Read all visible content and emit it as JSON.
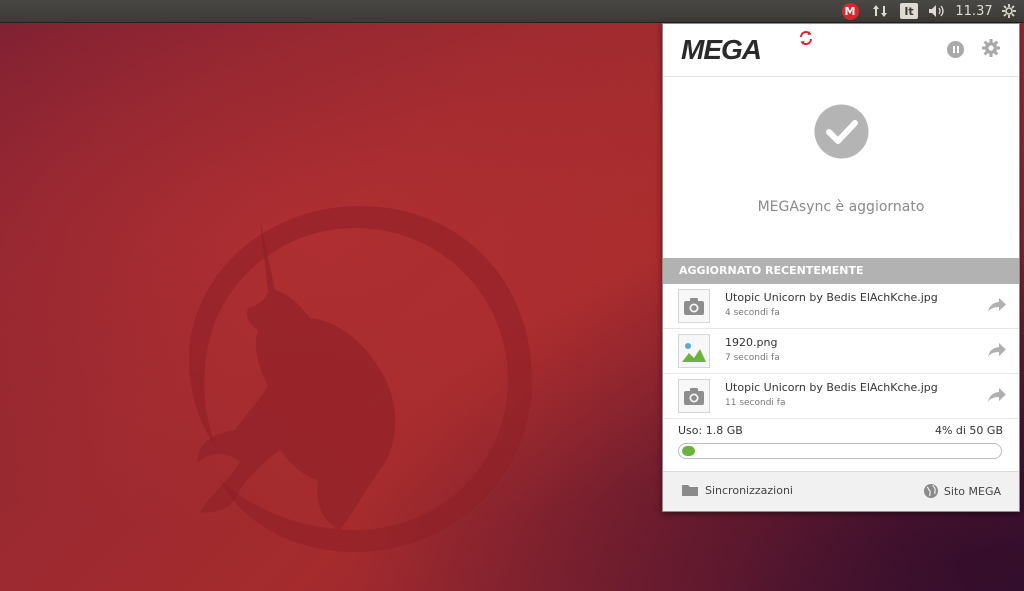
{
  "panel": {
    "mega_tray_letter": "M",
    "keyboard_layout": "It",
    "clock": "11.37"
  },
  "popup": {
    "logo_text": "MEGA",
    "status_text": "MEGAsync è aggiornato",
    "recent_header": "AGGIORNATO RECENTEMENTE",
    "recent_items": [
      {
        "name": "Utopic Unicorn  by Bedis ElAchKche.jpg",
        "time": "4 secondi fa",
        "icon": "camera-icon"
      },
      {
        "name": "1920.png",
        "time": "7 secondi fa",
        "icon": "image-icon"
      },
      {
        "name": "Utopic Unicorn  by Bedis ElAchKche.jpg",
        "time": "11 secondi fa",
        "icon": "camera-icon"
      }
    ],
    "usage_label": "Uso: 1.8 GB",
    "usage_percent_text": "4% di 50 GB",
    "usage_fraction": 0.04,
    "sync_label": "Sincronizzazioni",
    "site_label": "Sito MEGA"
  },
  "colors": {
    "mega_red": "#d9272e",
    "progress_green": "#6cb33e",
    "header_gray": "#b2b2b2"
  }
}
